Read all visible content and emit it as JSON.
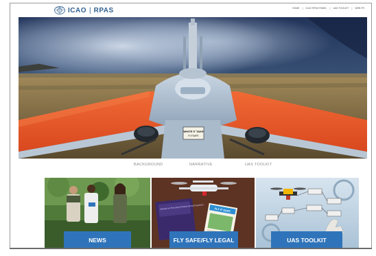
{
  "header": {
    "brand_icao": "ICAO",
    "brand_sep": "|",
    "brand_rpas": "RPAS",
    "top_links": [
      "HOME",
      "|",
      "ICAO RPAS PANEL",
      "|",
      "UAS TOOLKIT",
      "|",
      "WEB FR"
    ]
  },
  "hero": {
    "drone_plate_text": "WHITE IT TAKE",
    "drone_plate_sub": "FLYSAFE"
  },
  "menu": {
    "items": [
      {
        "label": "BACKGROUND"
      },
      {
        "label": "NARRATIVE"
      },
      {
        "label": "UAS TOOLKIT"
      }
    ]
  },
  "tiles": [
    {
      "label": "NEWS"
    },
    {
      "label": "FLY SAFE/FLY LEGAL"
    },
    {
      "label": "UAS TOOLKIT"
    }
  ],
  "tile_art": {
    "booklet_title": "Manual on Remotely Piloted Aircraft Systems",
    "flysafe_banner": "FLY IT SAFE"
  },
  "colors": {
    "accent_blue": "#2f74ba",
    "wing_orange": "#e8572a",
    "sky_dark": "#1b2a44",
    "brand_blue": "#2f5f8f"
  },
  "icons": [
    "icao-emblem-icon"
  ]
}
